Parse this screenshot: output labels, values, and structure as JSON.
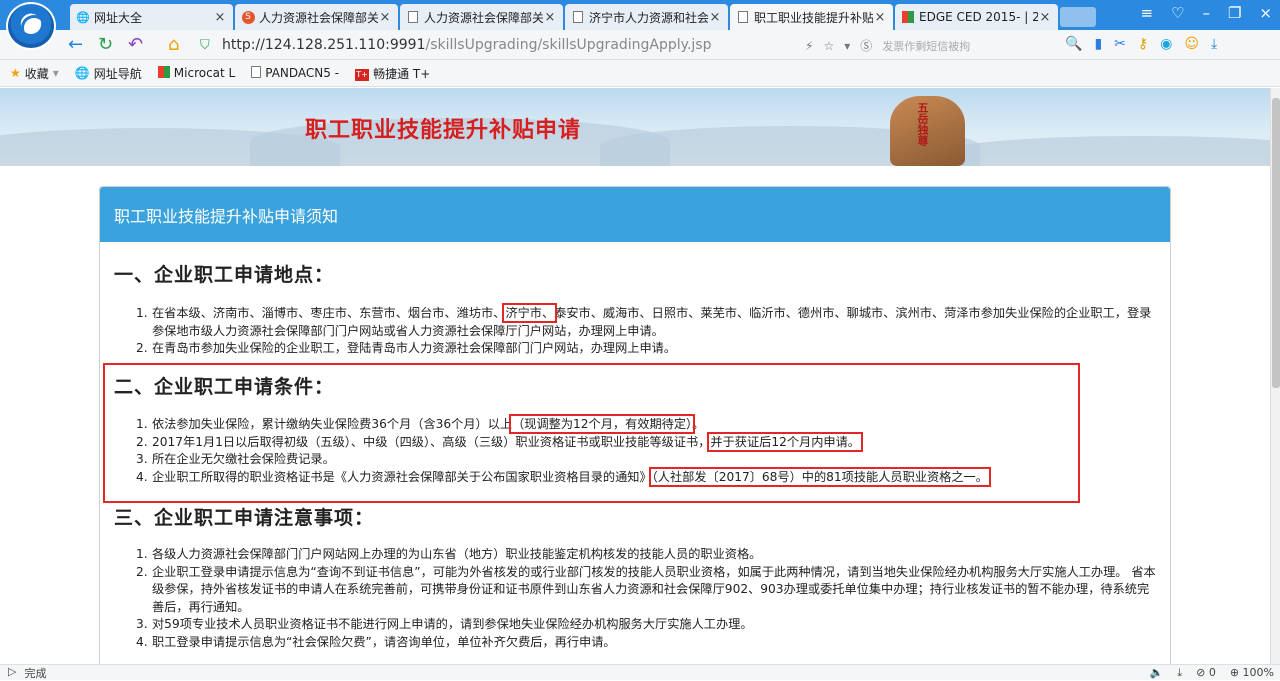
{
  "browser": {
    "tabs": [
      {
        "icon": "globe-icon",
        "label": "网址大全",
        "active": false
      },
      {
        "icon": "s-icon",
        "label": "人力资源社会保障部关",
        "active": false
      },
      {
        "icon": "doc-icon",
        "label": "人力资源社会保障部关",
        "active": false
      },
      {
        "icon": "doc-icon",
        "label": "济宁市人力资源和社会",
        "active": false
      },
      {
        "icon": "doc-icon",
        "label": "职工职业技能提升补贴",
        "active": true
      },
      {
        "icon": "edge-icon",
        "label": "EDGE CED 2015- | 2",
        "active": false
      }
    ],
    "url_host": "http://124.128.251.110:9991",
    "url_path": "/skillsUpgrading/skillsUpgradingApply.jsp",
    "search_hint": "发票作剩短信被拘",
    "bookmarks": [
      {
        "icon": "star-icon",
        "label": "收藏"
      },
      {
        "icon": "globe-icon",
        "label": "网址导航"
      },
      {
        "icon": "microsoft-icon",
        "label": "Microcat L"
      },
      {
        "icon": "doc-icon",
        "label": "PANDACN5 -"
      },
      {
        "icon": "t-icon",
        "label": "畅捷通 T+"
      }
    ],
    "status": "完成",
    "zoom": "100%",
    "download_count": "0"
  },
  "page": {
    "banner_title": "职工职业技能提升补贴申请",
    "banner_rock_text": "五岳独尊",
    "panel_title": "职工职业技能提升补贴申请须知",
    "sections": [
      {
        "heading": "一、企业职工申请地点：",
        "items": [
          {
            "num": "1.",
            "parts": [
              {
                "t": "在省本级、济南市、淄博市、枣庄市、东营市、烟台市、潍坊市、"
              },
              {
                "t": "济宁市、",
                "hl": true
              },
              {
                "t": "泰安市、威海市、日照市、莱芜市、临沂市、德州市、聊城市、滨州市、菏泽市参加失业保险的企业职工，登录参保地市级人力资源社会保障部门门户网站或省人力资源社会保障厅门户网站，办理网上申请。"
              }
            ]
          },
          {
            "num": "2.",
            "parts": [
              {
                "t": "在青岛市参加失业保险的企业职工，登陆青岛市人力资源社会保障部门门户网站，办理网上申请。"
              }
            ]
          }
        ]
      },
      {
        "heading": "二、企业职工申请条件：",
        "items": [
          {
            "num": "1.",
            "parts": [
              {
                "t": "依法参加失业保险，累计缴纳失业保险费36个月（含36个月）以上"
              },
              {
                "t": "（现调整为12个月，有效期待定）",
                "hl": true
              },
              {
                "t": "。"
              }
            ]
          },
          {
            "num": "2.",
            "parts": [
              {
                "t": "2017年1月1日以后取得初级（五级）、中级（四级）、高级（三级）职业资格证书或职业技能等级证书，"
              },
              {
                "t": "并于获证后12个月内申请。",
                "hl": true
              }
            ]
          },
          {
            "num": "3.",
            "parts": [
              {
                "t": "所在企业无欠缴社会保险费记录。"
              }
            ]
          },
          {
            "num": "4.",
            "parts": [
              {
                "t": "企业职工所取得的职业资格证书是《人力资源社会保障部关于公布国家职业资格目录的通知》"
              },
              {
                "t": "（人社部发〔2017〕68号）中的81项技能人员职业资格之一。",
                "hl": true
              }
            ]
          }
        ]
      },
      {
        "heading": "三、企业职工申请注意事项：",
        "items": [
          {
            "num": "1.",
            "parts": [
              {
                "t": "各级人力资源社会保障部门门户网站网上办理的为山东省（地方）职业技能鉴定机构核发的技能人员的职业资格。"
              }
            ]
          },
          {
            "num": "2.",
            "parts": [
              {
                "t": "企业职工登录申请提示信息为“查询不到证书信息”，可能为外省核发的或行业部门核发的技能人员职业资格，如属于此两种情况，请到当地失业保险经办机构服务大厅实施人工办理。 省本级参保，持外省核发证书的申请人在系统完善前，可携带身份证和证书原件到山东省人力资源和社会保障厅902、903办理或委托单位集中办理；持行业核发证书的暂不能办理，待系统完善后，再行通知。"
              }
            ]
          },
          {
            "num": "3.",
            "parts": [
              {
                "t": "对59项专业技术人员职业资格证书不能进行网上申请的，请到参保地失业保险经办机构服务大厅实施人工办理。"
              }
            ]
          },
          {
            "num": "4.",
            "parts": [
              {
                "t": "职工登录申请提示信息为“社会保险欠费”，请咨询单位，单位补齐欠费后，再行申请。"
              }
            ]
          }
        ]
      }
    ]
  }
}
